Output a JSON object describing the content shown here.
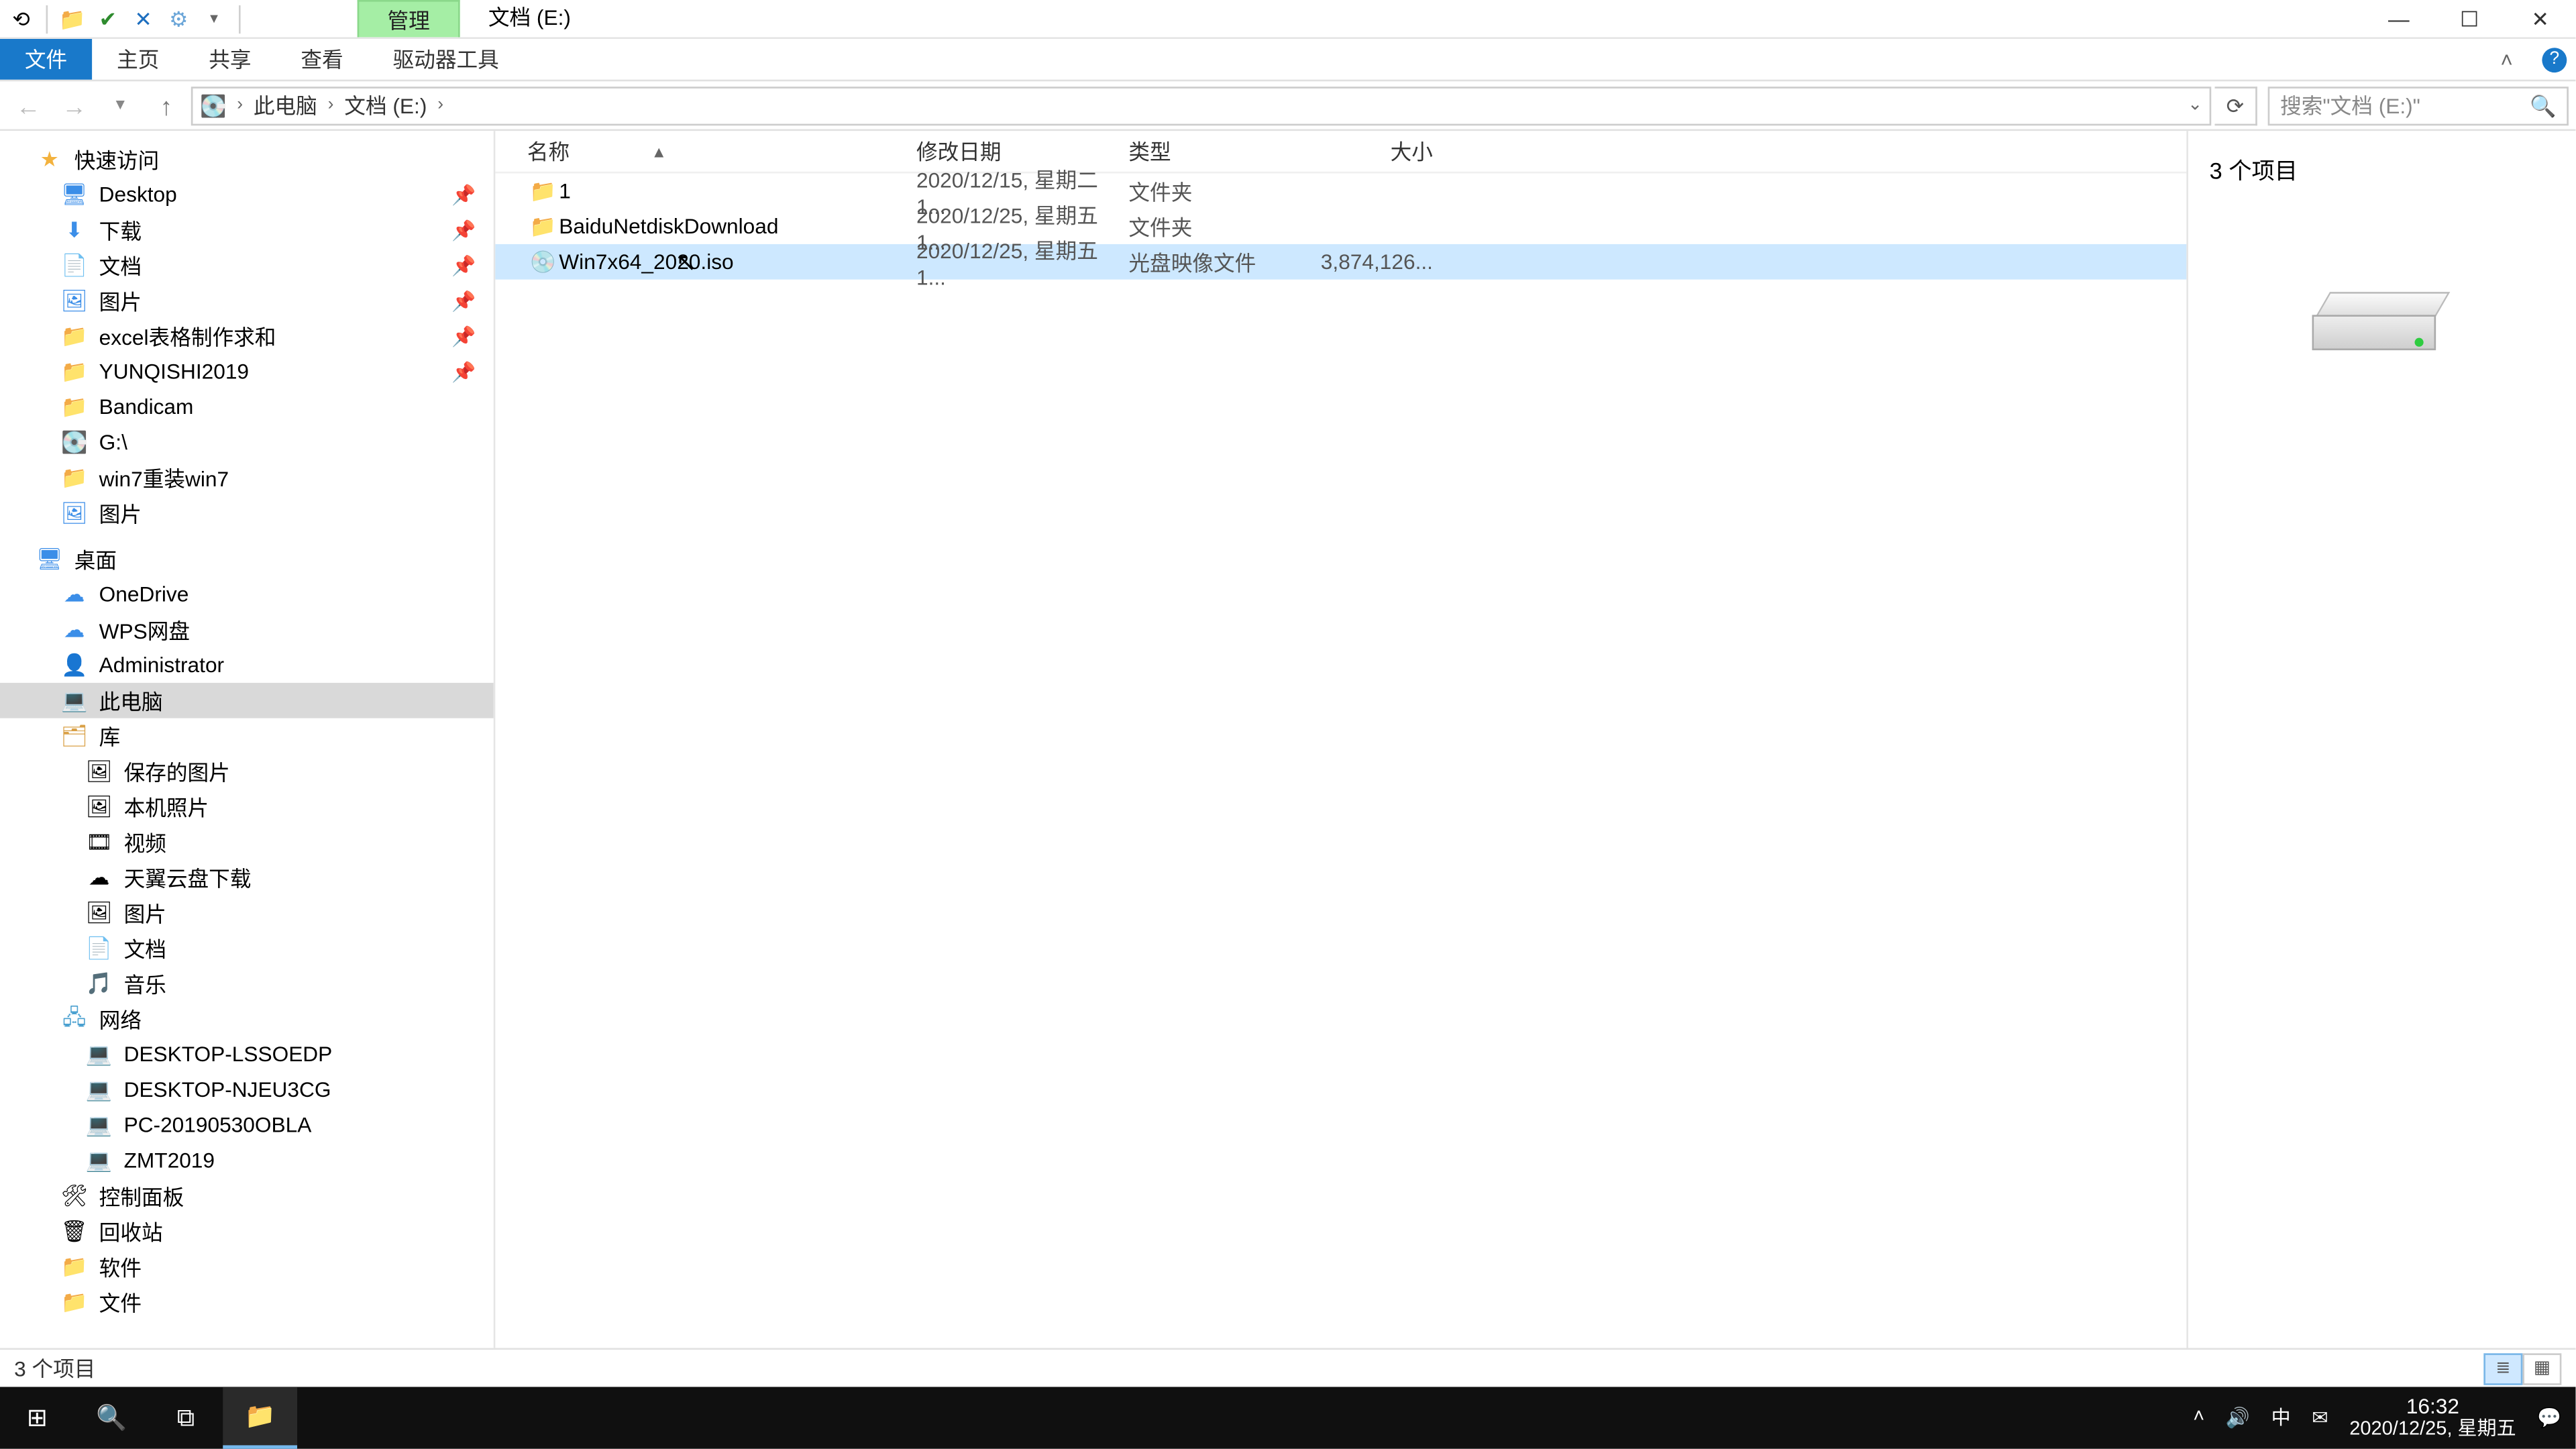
{
  "title": {
    "context_tab": "管理",
    "window_title": "文档 (E:)"
  },
  "ribbon": {
    "file": "文件",
    "home": "主页",
    "share": "共享",
    "view": "查看",
    "drive_tools": "驱动器工具"
  },
  "nav": {
    "crumb_pc": "此电脑",
    "crumb_drive": "文档 (E:)",
    "search_placeholder": "搜索\"文档 (E:)\""
  },
  "columns": {
    "name": "名称",
    "date": "修改日期",
    "type": "类型",
    "size": "大小"
  },
  "rows": [
    {
      "icon": "folder",
      "name": "1",
      "date": "2020/12/15, 星期二 1...",
      "type": "文件夹",
      "size": ""
    },
    {
      "icon": "folder",
      "name": "BaiduNetdiskDownload",
      "date": "2020/12/25, 星期五 1...",
      "type": "文件夹",
      "size": ""
    },
    {
      "icon": "iso",
      "name": "Win7x64_2020.iso",
      "date": "2020/12/25, 星期五 1...",
      "type": "光盘映像文件",
      "size": "3,874,126..."
    }
  ],
  "tree": {
    "quick_access": "快速访问",
    "qa_items": [
      {
        "icon": "desktop",
        "label": "Desktop",
        "pin": true
      },
      {
        "icon": "dl",
        "label": "下载",
        "pin": true
      },
      {
        "icon": "doc",
        "label": "文档",
        "pin": true
      },
      {
        "icon": "pic",
        "label": "图片",
        "pin": true
      },
      {
        "icon": "folder",
        "label": "excel表格制作求和",
        "pin": true
      },
      {
        "icon": "folder",
        "label": "YUNQISHI2019",
        "pin": true
      },
      {
        "icon": "folder",
        "label": "Bandicam",
        "pin": false
      },
      {
        "icon": "drive",
        "label": "G:\\",
        "pin": false
      },
      {
        "icon": "folder",
        "label": "win7重装win7",
        "pin": false
      },
      {
        "icon": "pic",
        "label": "图片",
        "pin": false
      }
    ],
    "desktop": "桌面",
    "desktop_items": [
      {
        "icon": "cloud",
        "label": "OneDrive"
      },
      {
        "icon": "cloud",
        "label": "WPS网盘"
      },
      {
        "icon": "user",
        "label": "Administrator"
      },
      {
        "icon": "pc",
        "label": "此电脑",
        "selected": true
      },
      {
        "icon": "lib",
        "label": "库"
      }
    ],
    "lib_items": [
      {
        "label": "保存的图片"
      },
      {
        "label": "本机照片"
      },
      {
        "label": "视频"
      },
      {
        "label": "天翼云盘下载"
      },
      {
        "label": "图片"
      },
      {
        "label": "文档"
      },
      {
        "label": "音乐"
      }
    ],
    "network": "网络",
    "net_items": [
      {
        "label": "DESKTOP-LSSOEDP"
      },
      {
        "label": "DESKTOP-NJEU3CG"
      },
      {
        "label": "PC-20190530OBLA"
      },
      {
        "label": "ZMT2019"
      }
    ],
    "tail_items": [
      {
        "icon": "panel",
        "label": "控制面板"
      },
      {
        "icon": "recycle",
        "label": "回收站"
      },
      {
        "icon": "folder",
        "label": "软件"
      },
      {
        "icon": "folder",
        "label": "文件"
      }
    ]
  },
  "preview": {
    "count_text": "3 个项目"
  },
  "status": {
    "text": "3 个项目"
  },
  "taskbar": {
    "ime": "中",
    "time": "16:32",
    "date": "2020/12/25, 星期五"
  }
}
